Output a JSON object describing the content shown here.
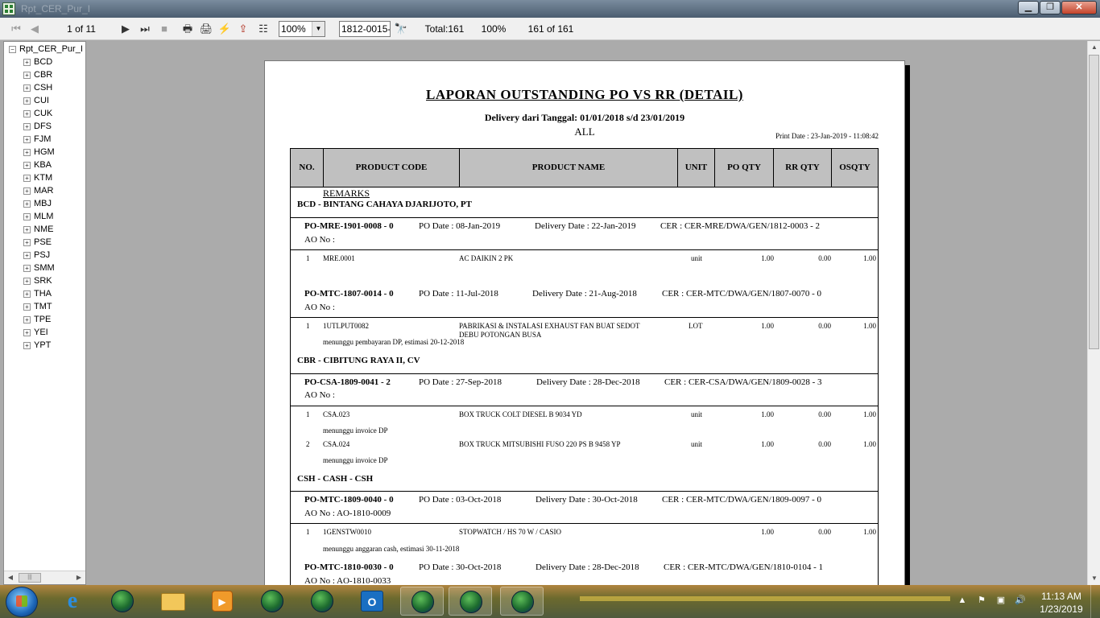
{
  "window": {
    "title": "Rpt_CER_Pur_I"
  },
  "toolbar": {
    "page_indicator": "1 of 11",
    "zoom_value": "100%",
    "search_value": "1812-0015-1",
    "total_label": "Total:161",
    "percent_label": "100%",
    "record_label": "161 of 161"
  },
  "tree": {
    "root": "Rpt_CER_Pur_I",
    "items": [
      "BCD",
      "CBR",
      "CSH",
      "CUI",
      "CUK",
      "DFS",
      "FJM",
      "HGM",
      "KBA",
      "KTM",
      "MAR",
      "MBJ",
      "MLM",
      "NME",
      "PSE",
      "PSJ",
      "SMM",
      "SRK",
      "THA",
      "TMT",
      "TPE",
      "YEI",
      "YPT"
    ]
  },
  "report": {
    "title": "LAPORAN OUTSTANDING PO VS RR (DETAIL)",
    "subtitle": "Delivery dari Tanggal: 01/01/2018 s/d 23/01/2019",
    "filter": "ALL",
    "print_date": "Print Date : 23-Jan-2019 - 11:08:42",
    "columns": {
      "no": "NO.",
      "product_code": "PRODUCT CODE",
      "product_name": "PRODUCT NAME",
      "unit": "UNIT",
      "po_qty": "PO QTY",
      "rr_qty": "RR QTY",
      "os_qty": "OSQTY"
    },
    "remarks_label": "REMARKS",
    "groups": {
      "bcd": "BCD - BINTANG CAHAYA DJARIJOTO, PT",
      "cbr": "CBR - CIBITUNG RAYA II, CV",
      "csh": "CSH - CASH - CSH"
    },
    "pos": {
      "p1": {
        "no": "PO-MRE-1901-0008 - 0",
        "po_date": "PO Date : 08-Jan-2019",
        "delivery": "Delivery Date : 22-Jan-2019",
        "cer": "CER : CER-MRE/DWA/GEN/1812-0003 - 2",
        "ao": "AO No   :"
      },
      "p2": {
        "no": "PO-MTC-1807-0014 - 0",
        "po_date": "PO Date : 11-Jul-2018",
        "delivery": "Delivery Date : 21-Aug-2018",
        "cer": "CER : CER-MTC/DWA/GEN/1807-0070 - 0",
        "ao": "AO No   :"
      },
      "p3": {
        "no": "PO-CSA-1809-0041 - 2",
        "po_date": "PO Date : 27-Sep-2018",
        "delivery": "Delivery Date : 28-Dec-2018",
        "cer": "CER : CER-CSA/DWA/GEN/1809-0028 - 3",
        "ao": "AO No   :"
      },
      "p4": {
        "no": "PO-MTC-1809-0040 - 0",
        "po_date": "PO Date : 03-Oct-2018",
        "delivery": "Delivery Date : 30-Oct-2018",
        "cer": "CER : CER-MTC/DWA/GEN/1809-0097 - 0",
        "ao": "AO No   :  AO-1810-0009"
      },
      "p5": {
        "no": "PO-MTC-1810-0030 - 0",
        "po_date": "PO Date : 30-Oct-2018",
        "delivery": "Delivery Date : 28-Dec-2018",
        "cer": "CER : CER-MTC/DWA/GEN/1810-0104 - 1",
        "ao": "AO No   :  AO-1810-0033"
      }
    },
    "items": {
      "i1": {
        "no": "1",
        "code": "MRE.0001",
        "name": "AC DAIKIN 2 PK",
        "name2": "",
        "unit": "unit",
        "po": "1.00",
        "rr": "0.00",
        "os": "1.00",
        "note": ""
      },
      "i2": {
        "no": "1",
        "code": "1UTLPUT0082",
        "name": "PABRIKASI & INSTALASI EXHAUST FAN BUAT SEDOT",
        "name2": "DEBU POTONGAN BUSA",
        "unit": "LOT",
        "po": "1.00",
        "rr": "0.00",
        "os": "1.00",
        "note": "menunggu pembayaran DP, estimasi 20-12-2018"
      },
      "i3": {
        "no": "1",
        "code": "CSA.023",
        "name": "BOX TRUCK COLT DIESEL B 9034 YD",
        "name2": "",
        "unit": "unit",
        "po": "1.00",
        "rr": "0.00",
        "os": "1.00",
        "note": "menunggu invoice DP"
      },
      "i4": {
        "no": "2",
        "code": "CSA.024",
        "name": "BOX TRUCK MITSUBISHI FUSO 220 PS  B 9458 YP",
        "name2": "",
        "unit": "unit",
        "po": "1.00",
        "rr": "0.00",
        "os": "1.00",
        "note": "menunggu invoice DP"
      },
      "i5": {
        "no": "1",
        "code": "1GENSTW0010",
        "name": "STOPWATCH / HS 70 W / CASIO",
        "name2": "",
        "unit": "",
        "po": "1.00",
        "rr": "0.00",
        "os": "1.00",
        "note": "menunggu anggaran cash, estimasi 30-11-2018"
      }
    }
  },
  "taskbar": {
    "clock_time": "11:13 AM",
    "clock_date": "1/23/2019"
  },
  "icons": [
    "app-icon",
    "first-page-icon",
    "prev-page-icon",
    "next-page-icon",
    "last-page-icon",
    "stop-icon",
    "print-icon",
    "print-setup-icon",
    "refresh-icon",
    "export-icon",
    "group-tree-icon",
    "search-icon",
    "start-orb-icon",
    "ie-icon",
    "globe-icon",
    "folder-icon",
    "media-player-icon",
    "outlook-icon"
  ]
}
